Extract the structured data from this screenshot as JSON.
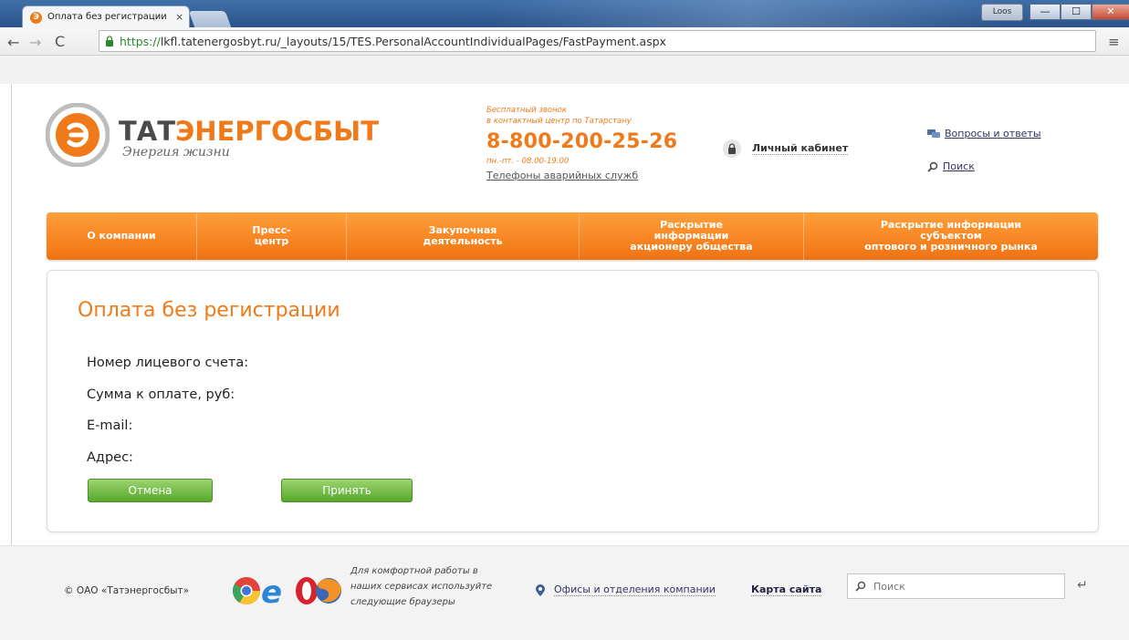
{
  "browser": {
    "tab_title": "Оплата без регистрации",
    "tab_close": "×",
    "window_user": "Loos",
    "window_minimize": "—",
    "window_maximize": "☐",
    "window_close": "✕",
    "back": "←",
    "forward": "→",
    "reload": "C",
    "url_scheme": "https://",
    "url_rest": "lkfl.tatenergosbyt.ru/_layouts/15/TES.PersonalAccountIndividualPages/FastPayment.aspx",
    "menu": "≡"
  },
  "header": {
    "logo_name_dark": "ТАТ",
    "logo_name_accent": "ЭНЕРГОСБЫТ",
    "logo_slogan": "Энергия жизни",
    "callcenter_note_1": "Бесплатный звонок",
    "callcenter_note_2": "в контактный центр по Татарстану",
    "phone": "8-800-200-25-26",
    "hours": "пн.-пт. - 08.00-19.00",
    "emergency_link": "Телефоны аварийных служб",
    "cabinet_label": "Личный кабинет",
    "faq_label": "Вопросы и ответы",
    "search_label": "Поиск"
  },
  "menu": {
    "items": [
      {
        "label": "О компании"
      },
      {
        "label": "Пресс-\nцентр"
      },
      {
        "label": "Закупочная\nдеятельность"
      },
      {
        "label": "Раскрытие\nинформации\nакционеру общества"
      },
      {
        "label": "Раскрытие информации\nсубъектом\nоптового и розничного рынка"
      }
    ]
  },
  "main": {
    "title": "Оплата без регистрации",
    "fields": [
      {
        "label": "Номер лицевого счета:"
      },
      {
        "label": "Сумма к оплате, руб:"
      },
      {
        "label": "E-mail:"
      },
      {
        "label": "Адрес:"
      }
    ],
    "cancel_button": "Отмена",
    "accept_button": "Принять"
  },
  "footer": {
    "copyright": "© ОАО «Татэнергосбыт»",
    "browser_note": "Для комфортной работы в\nнаших сервисах используйте\nследующие браузеры",
    "offices_label": "Офисы и отделения компании",
    "sitemap_label": "Карта сайта",
    "search_placeholder": "Поиск",
    "enter_glyph": "↵"
  },
  "colors": {
    "accent": "#f07a1a",
    "button_green": "#56a82c"
  }
}
